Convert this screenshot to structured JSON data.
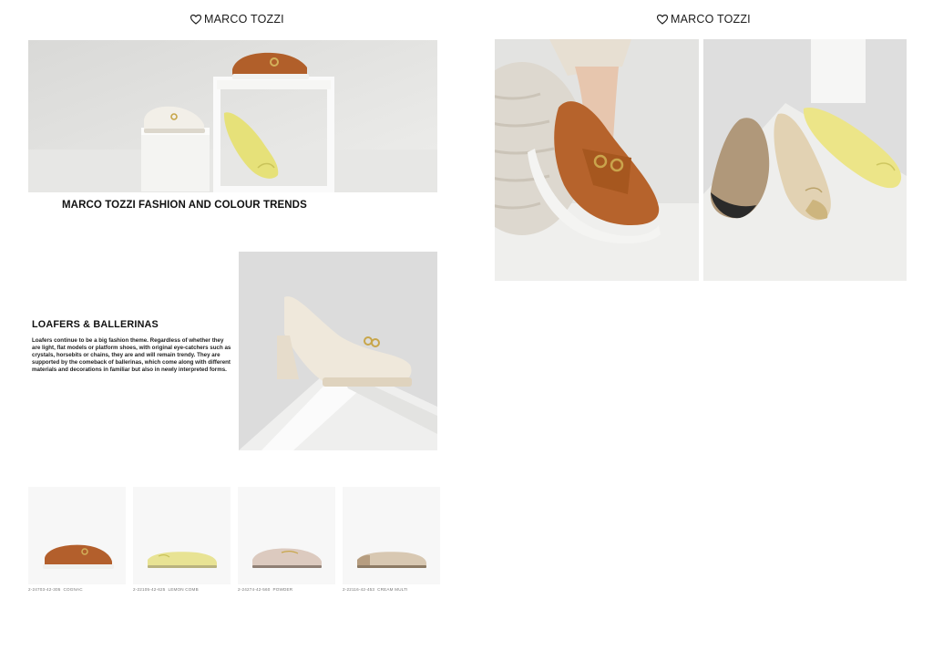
{
  "brand": "MARCO TOZZI",
  "left_page": {
    "heading": "MARCO TOZZI FASHION AND COLOUR TRENDS",
    "section_title": "LOAFERS & BALLERINAS",
    "section_body": "Loafers continue to be a big fashion theme. Regardless of whether they are light, flat models or platform shoes, with original eye-catchers such as crystals, horsebits or chains, they are and will remain trendy. They are supported by the comeback of ballerinas, which come along with different materials and decorations in familiar but also in newly interpreted forms.",
    "products": [
      {
        "code": "2-24703-42-305",
        "color": "COGNAC"
      },
      {
        "code": "2-22105-42-625",
        "color": "LEMON COMB"
      },
      {
        "code": "2-24274-42-560",
        "color": "POWDER"
      },
      {
        "code": "2-22116-42-453",
        "color": "CREAM MULTI"
      }
    ]
  },
  "colors": {
    "cognac": "#b8602c",
    "lemon": "#e9e38c",
    "cream": "#f1ece1",
    "powder": "#d9c7bb"
  }
}
